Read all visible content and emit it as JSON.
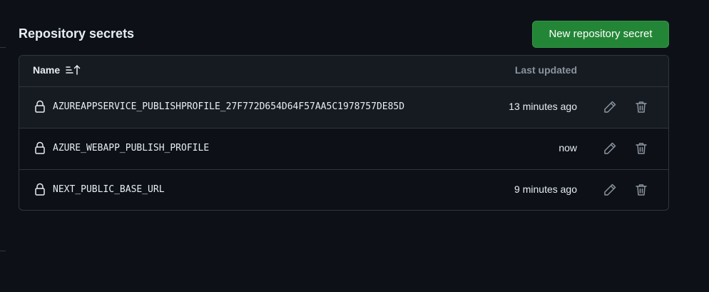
{
  "section": {
    "title": "Repository secrets",
    "new_button_label": "New repository secret"
  },
  "table": {
    "headers": {
      "name": "Name",
      "last_updated": "Last updated"
    },
    "rows": [
      {
        "name": "AZUREAPPSERVICE_PUBLISHPROFILE_27F772D654D64F57AA5C1978757DE85D",
        "updated": "13 minutes ago"
      },
      {
        "name": "AZURE_WEBAPP_PUBLISH_PROFILE",
        "updated": "now"
      },
      {
        "name": "NEXT_PUBLIC_BASE_URL",
        "updated": "9 minutes ago"
      }
    ]
  },
  "icons": {
    "sort": "sort-ascending-icon",
    "lock": "lock-icon",
    "edit": "pencil-icon",
    "delete": "trash-icon"
  },
  "colors": {
    "background": "#0d1117",
    "header_bg": "#161b22",
    "border": "#30363d",
    "primary_button": "#238636",
    "muted_text": "#8b949e",
    "icon": "#8b949e"
  }
}
